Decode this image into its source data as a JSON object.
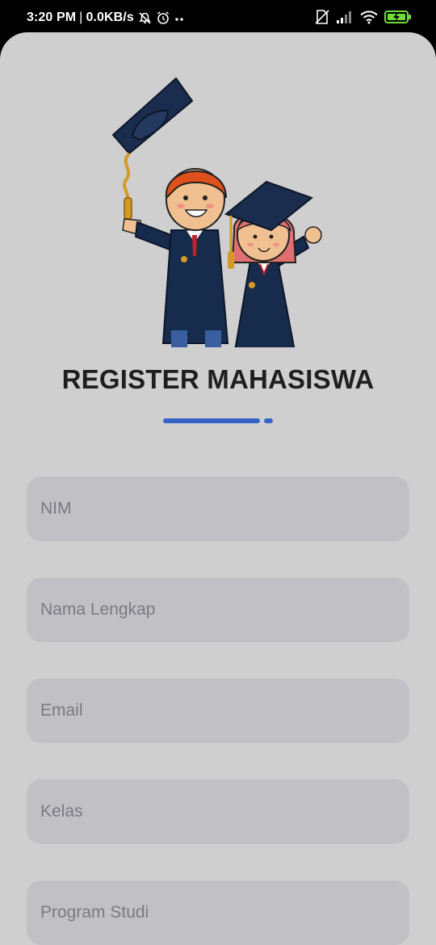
{
  "status_bar": {
    "time": "3:20 PM",
    "separator": "|",
    "net_speed": "0.0KB/s",
    "icons": [
      "bell-off-icon",
      "alarm-icon",
      "more-dots-icon",
      "no-sim-icon",
      "signal-icon",
      "wifi-icon",
      "battery-charging-icon"
    ]
  },
  "illustration": {
    "icon": "graduation-students-illustration"
  },
  "page": {
    "title": "REGISTER MAHASISWA"
  },
  "form": {
    "nim_placeholder": "NIM",
    "nama_placeholder": "Nama Lengkap",
    "email_placeholder": "Email",
    "kelas_placeholder": "Kelas",
    "prodi_placeholder": "Program Studi"
  },
  "colors": {
    "background": "#cfcfd0",
    "field": "#c1c1c5",
    "accent": "#3464c8",
    "title": "#1f1f1f",
    "battery": "#6fdc3a"
  }
}
